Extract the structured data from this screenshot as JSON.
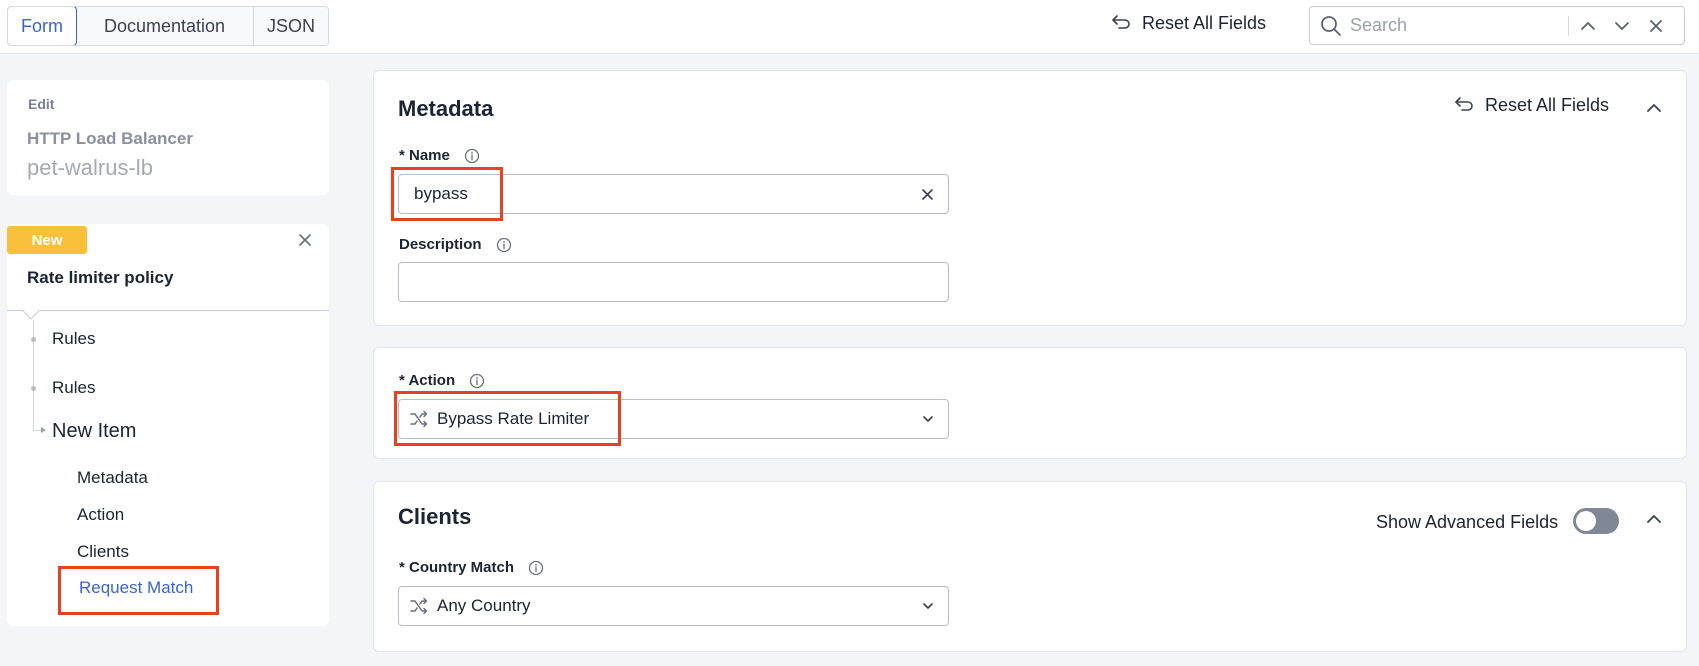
{
  "topbar": {
    "tabs": [
      {
        "label": "Form",
        "active": true
      },
      {
        "label": "Documentation",
        "active": false
      },
      {
        "label": "JSON",
        "active": false
      }
    ],
    "reset_label": "Reset All Fields",
    "search_placeholder": "Search"
  },
  "sidebar": {
    "edit_label": "Edit",
    "object_type": "HTTP Load Balancer",
    "object_name": "pet-walrus-lb",
    "badge": "New",
    "policy_title": "Rate limiter policy",
    "tree": {
      "rules_1": "Rules",
      "rules_2": "Rules",
      "new_item": "New Item"
    },
    "sections": [
      "Metadata",
      "Action",
      "Clients",
      "Request Match"
    ],
    "active_section": "Request Match"
  },
  "metadata": {
    "title": "Metadata",
    "reset_label": "Reset All Fields",
    "name_label": "* Name",
    "name_value": "bypass",
    "description_label": "Description",
    "description_value": ""
  },
  "action": {
    "label": "* Action",
    "value": "Bypass Rate Limiter"
  },
  "clients": {
    "title": "Clients",
    "advanced_label": "Show Advanced Fields",
    "advanced_enabled": false,
    "country_label": "* Country Match",
    "country_value": "Any Country"
  },
  "colors": {
    "accent": "#3a63d8",
    "badge": "#f9c13b",
    "highlight": "#e8411f"
  }
}
